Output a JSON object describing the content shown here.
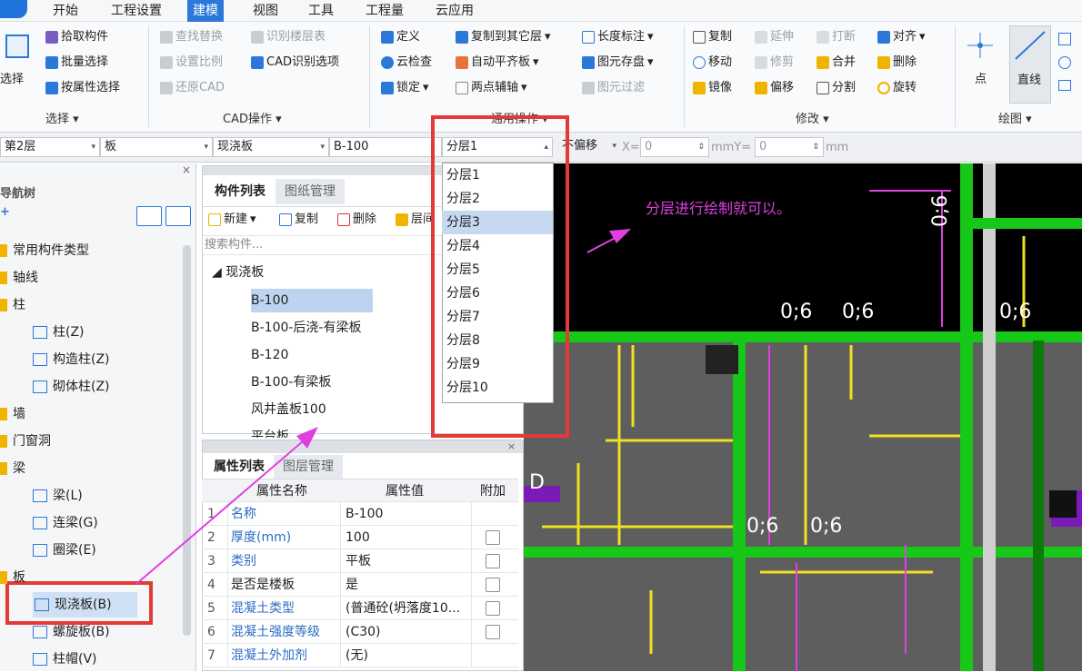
{
  "menu": [
    "开始",
    "工程设置",
    "建模",
    "视图",
    "工具",
    "工程量",
    "云应用"
  ],
  "active_menu": "建模",
  "ribbon": {
    "select_big": "选择",
    "select_items": [
      "拾取构件",
      "批量选择",
      "按属性选择"
    ],
    "select_group": "选择",
    "cad_items": [
      "查找替换",
      "识别楼层表",
      "设置比例",
      "CAD识别选项",
      "还原CAD"
    ],
    "cad_group": "CAD操作",
    "common_items": [
      "定义",
      "复制到其它层",
      "长度标注",
      "云检查",
      "自动平齐板",
      "图元存盘",
      "锁定",
      "两点辅轴",
      "图元过滤"
    ],
    "common_group": "通用操作",
    "modify_items": [
      "复制",
      "延伸",
      "打断",
      "对齐",
      "移动",
      "修剪",
      "合并",
      "删除",
      "镜像",
      "偏移",
      "分割",
      "旋转"
    ],
    "modify_group": "修改",
    "draw_items": [
      "点",
      "直线"
    ],
    "draw_group": "绘图"
  },
  "toolbar": {
    "floor": "第2层",
    "category": "板",
    "type": "现浇板",
    "component": "B-100",
    "layer": "分层1",
    "offset": "不偏移",
    "x_label": "X=",
    "x_value": "0",
    "unit1": "mm",
    "y_label": "Y=",
    "y_value": "0",
    "unit2": "mm"
  },
  "nav": {
    "title": "导航树",
    "items": [
      {
        "label": "常用构件类型",
        "level": 0
      },
      {
        "label": "轴线",
        "level": 0
      },
      {
        "label": "柱",
        "level": 0
      },
      {
        "label": "柱(Z)",
        "level": 1
      },
      {
        "label": "构造柱(Z)",
        "level": 1
      },
      {
        "label": "砌体柱(Z)",
        "level": 1
      },
      {
        "label": "墙",
        "level": 0
      },
      {
        "label": "门窗洞",
        "level": 0
      },
      {
        "label": "梁",
        "level": 0
      },
      {
        "label": "梁(L)",
        "level": 1
      },
      {
        "label": "连梁(G)",
        "level": 1
      },
      {
        "label": "圈梁(E)",
        "level": 1
      },
      {
        "label": "板",
        "level": 0
      },
      {
        "label": "现浇板(B)",
        "level": 1,
        "selected": true
      },
      {
        "label": "螺旋板(B)",
        "level": 1
      },
      {
        "label": "柱帽(V)",
        "level": 1
      }
    ]
  },
  "component_list": {
    "tabs": [
      "构件列表",
      "图纸管理"
    ],
    "actions": [
      "新建",
      "复制",
      "删除",
      "层间"
    ],
    "search_placeholder": "搜索构件...",
    "group": "现浇板",
    "items": [
      "B-100",
      "B-100-后浇-有梁板",
      "B-120",
      "B-100-有梁板",
      "风井盖板100",
      "平台板"
    ]
  },
  "properties": {
    "tabs": [
      "属性列表",
      "图层管理"
    ],
    "headers": [
      "属性名称",
      "属性值",
      "附加"
    ],
    "rows": [
      {
        "n": "1",
        "name": "名称",
        "value": "B-100",
        "blue": true,
        "chk": false
      },
      {
        "n": "2",
        "name": "厚度(mm)",
        "value": "100",
        "blue": true,
        "chk": true
      },
      {
        "n": "3",
        "name": "类别",
        "value": "平板",
        "blue": true,
        "chk": true
      },
      {
        "n": "4",
        "name": "是否是楼板",
        "value": "是",
        "blue": false,
        "chk": true
      },
      {
        "n": "5",
        "name": "混凝土类型",
        "value": "(普通砼(坍落度10...",
        "blue": true,
        "chk": true
      },
      {
        "n": "6",
        "name": "混凝土强度等级",
        "value": "(C30)",
        "blue": true,
        "chk": true
      },
      {
        "n": "7",
        "name": "混凝土外加剂",
        "value": "(无)",
        "blue": true,
        "chk": false
      }
    ]
  },
  "layer_dropdown": [
    "分层1",
    "分层2",
    "分层3",
    "分层4",
    "分层5",
    "分层6",
    "分层7",
    "分层8",
    "分层9",
    "分层10"
  ],
  "layer_dropdown_highlight": "分层3",
  "annotation": "分层进行绘制就可以。",
  "canvas_labels": [
    "0;6",
    "0;6",
    "0;6",
    "0;6",
    "0;6",
    "0;6",
    "D"
  ],
  "colors": {
    "accent": "#2b78d8",
    "annotation": "#e040e0",
    "highlight_box": "#e53935",
    "canvas": "#000000"
  }
}
